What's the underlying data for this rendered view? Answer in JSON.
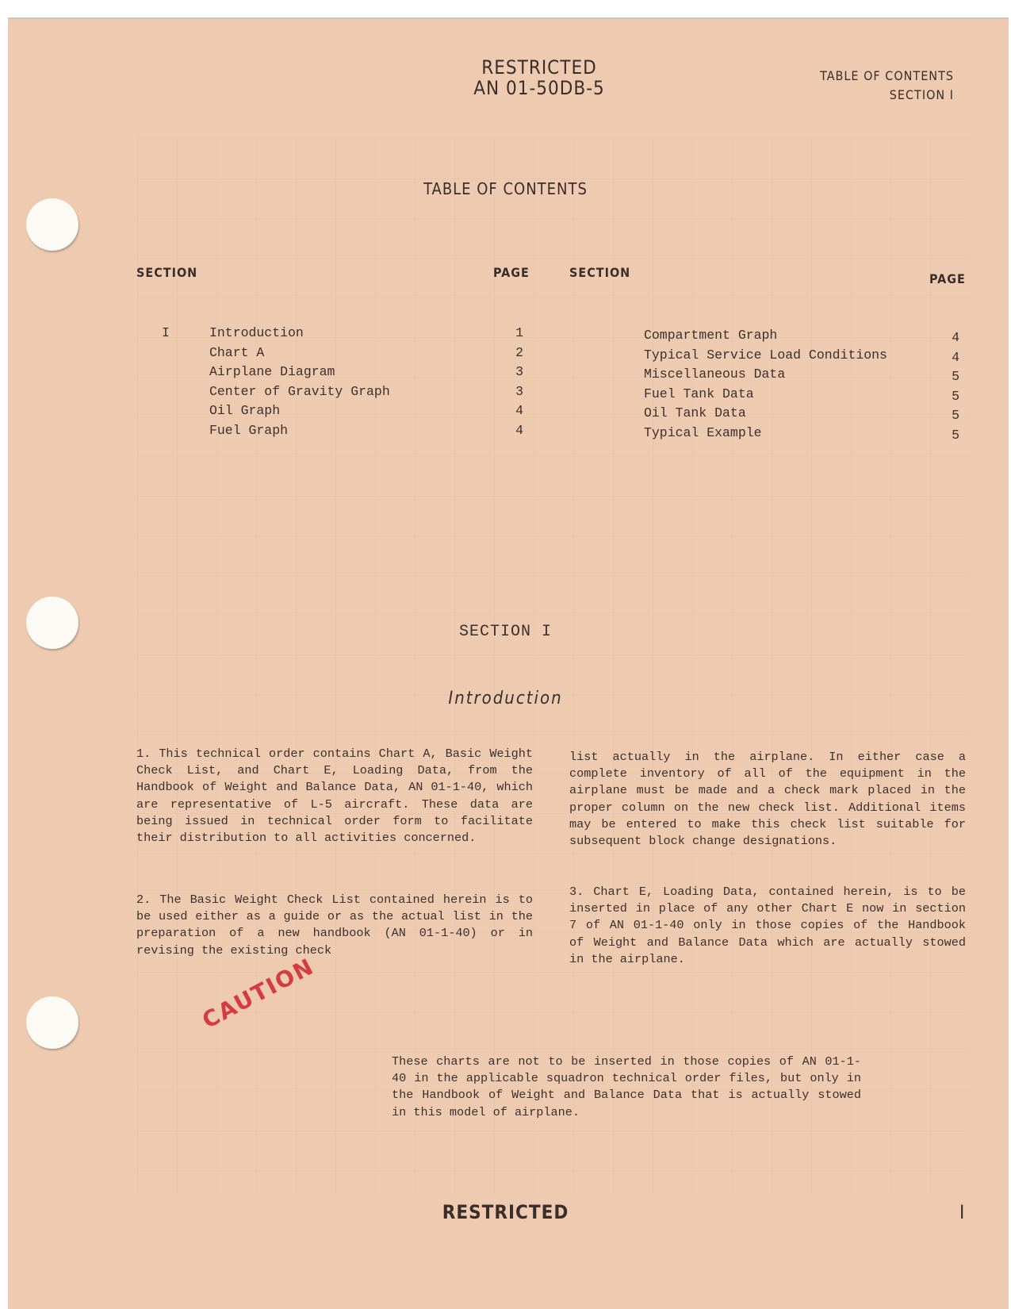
{
  "header": {
    "classification": "RESTRICTED",
    "document_number": "AN 01-50DB-5",
    "right_line1": "TABLE OF CONTENTS",
    "right_line2": "SECTION I"
  },
  "toc": {
    "title": "TABLE OF CONTENTS",
    "col_section": "SECTION",
    "col_page": "PAGE",
    "left_section_numeral": "I",
    "left_entries": [
      {
        "title": "Introduction",
        "page": "1"
      },
      {
        "title": "Chart A",
        "page": "2"
      },
      {
        "title": "Airplane Diagram",
        "page": "3"
      },
      {
        "title": "Center of Gravity Graph",
        "page": "3"
      },
      {
        "title": "Oil Graph",
        "page": "4"
      },
      {
        "title": "Fuel Graph",
        "page": "4"
      }
    ],
    "right_entries": [
      {
        "title": "Compartment Graph",
        "page": "4"
      },
      {
        "title": "Typical Service Load Conditions",
        "page": "4"
      },
      {
        "title": "Miscellaneous Data",
        "page": "5"
      },
      {
        "title": "Fuel Tank Data",
        "page": "5"
      },
      {
        "title": "Oil Tank Data",
        "page": "5"
      },
      {
        "title": "Typical Example",
        "page": "5"
      }
    ]
  },
  "section": {
    "heading": "SECTION I",
    "subheading": "Introduction"
  },
  "paragraphs": {
    "p1": "1. This technical order contains Chart A, Basic Weight Check List, and Chart E, Loading Data, from the Handbook of Weight and Balance Data, AN 01-1-40, which are representative of L-5 aircraft. These data are being issued in technical order form to facilitate their distribution to all activities concerned.",
    "p2_left": "2. The Basic Weight Check List contained herein is to be used either as a guide or as the actual list in the preparation of a new handbook (AN 01-1-40) or in revising the existing check",
    "p2_right": "list actually in the airplane. In either case a complete inventory of all of the equipment in the airplane must be made and a check mark placed in the proper column on the new check list. Additional items may be entered to make this check list suitable for subsequent block change designations.",
    "p3": "3. Chart E, Loading Data, contained herein, is to be inserted in place of any other Chart E now in section 7 of AN 01-1-40 only in those copies of the Handbook of Weight and Balance Data which are actually stowed in the airplane."
  },
  "caution": {
    "stamp": "CAUTION",
    "text": "These charts are not to be inserted in those copies of AN 01-1-40 in the applicable squadron technical order files, but only in the Handbook of Weight and Balance Data that is actually stowed in this model of airplane.",
    "stamp_color": "#d63a44"
  },
  "footer": {
    "classification": "RESTRICTED",
    "page_number": "I"
  }
}
